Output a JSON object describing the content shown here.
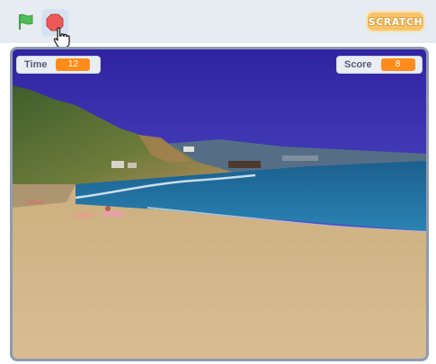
{
  "toolbar": {
    "green_flag_icon": "green-flag-icon",
    "stop_icon": "stop-icon",
    "logo_text": "SCRATCH"
  },
  "stage": {
    "scene": "beach-backdrop",
    "monitors": [
      {
        "label": "Time",
        "value": "12"
      },
      {
        "label": "Score",
        "value": "8"
      }
    ]
  },
  "colors": {
    "monitor_value_bg": "#ff8c1a",
    "stage_border": "#8f9bb0",
    "toolbar_bg": "#e6ecf2",
    "sky": "#3a30a8",
    "sea": "#1f6fa3",
    "sand": "#d6b98c"
  }
}
